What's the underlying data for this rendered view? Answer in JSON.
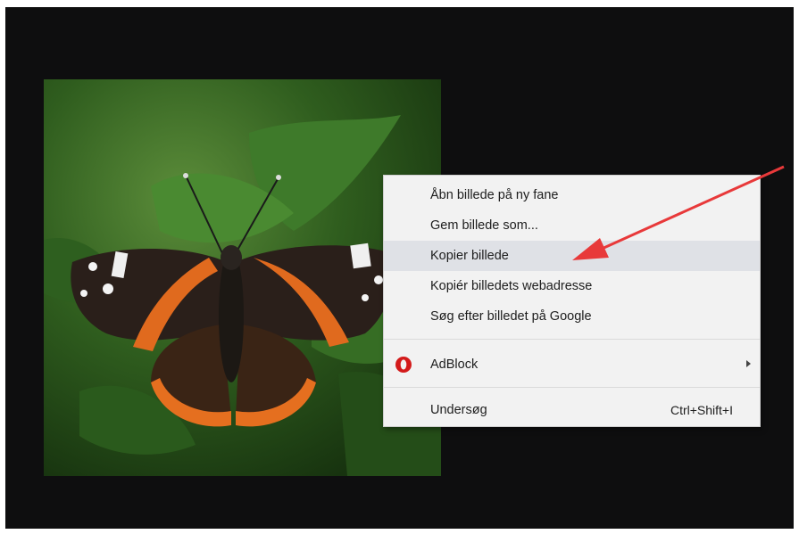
{
  "image": {
    "subject": "butterfly-photo"
  },
  "context_menu": {
    "items": [
      {
        "label": "Åbn billede på ny fane"
      },
      {
        "label": "Gem billede som..."
      },
      {
        "label": "Kopier billede"
      },
      {
        "label": "Kopiér billedets webadresse"
      },
      {
        "label": "Søg efter billedet på Google"
      },
      {
        "label": "AdBlock",
        "icon": "opera-o-icon"
      },
      {
        "label": "Undersøg",
        "shortcut": "Ctrl+Shift+I"
      }
    ]
  },
  "colors": {
    "viewer_bg": "#0e0e0f",
    "menu_bg": "#f2f2f2",
    "highlight": "#dfe1e6",
    "arrow": "#e8393a",
    "adblock_icon": "#d31a1a"
  }
}
